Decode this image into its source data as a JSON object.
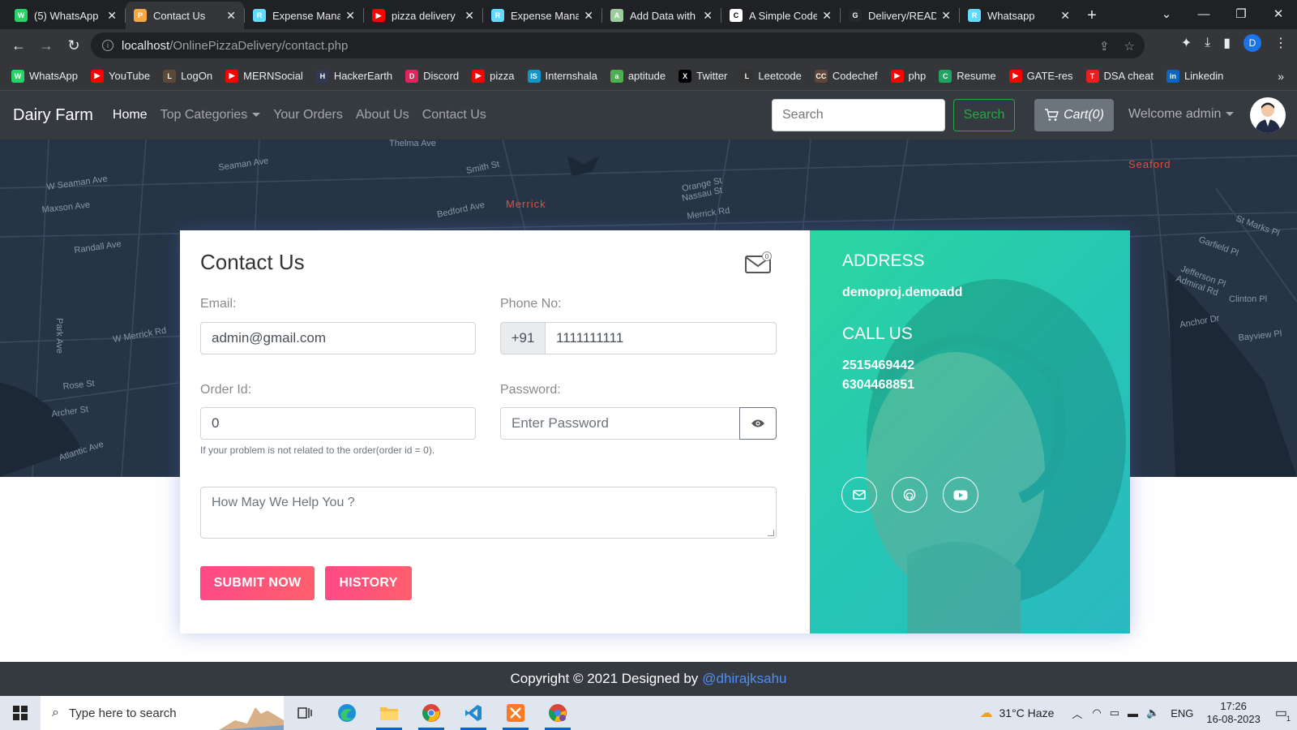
{
  "browser": {
    "tabs": [
      {
        "title": "(5) WhatsApp",
        "color": "#25d366",
        "glyph": "W",
        "active": false
      },
      {
        "title": "Contact Us",
        "color": "#f4a742",
        "glyph": "P",
        "active": true
      },
      {
        "title": "Expense Mana",
        "color": "#61dafb",
        "glyph": "R",
        "active": false
      },
      {
        "title": "pizza delivery",
        "color": "#ff0000",
        "glyph": "▶",
        "active": false
      },
      {
        "title": "Expense Mana",
        "color": "#61dafb",
        "glyph": "R",
        "active": false
      },
      {
        "title": "Add Data with",
        "color": "#9ccc9c",
        "glyph": "A",
        "active": false
      },
      {
        "title": "A Simple Code",
        "color": "#ffffff",
        "glyph": "C",
        "active": false
      },
      {
        "title": "Delivery/READ",
        "color": "#24292e",
        "glyph": "G",
        "active": false
      },
      {
        "title": "Whatsapp",
        "color": "#61dafb",
        "glyph": "R",
        "active": false
      }
    ],
    "url_host": "localhost",
    "url_path": "/OnlinePizzaDelivery/contact.php",
    "profile_initial": "D",
    "bookmarks": [
      {
        "label": "WhatsApp",
        "color": "#25d366",
        "glyph": "W"
      },
      {
        "label": "YouTube",
        "color": "#ff0000",
        "glyph": "▶"
      },
      {
        "label": "LogOn",
        "color": "#5a4a3a",
        "glyph": "L"
      },
      {
        "label": "MERNSocial",
        "color": "#ff0000",
        "glyph": "▶"
      },
      {
        "label": "HackerEarth",
        "color": "#323754",
        "glyph": "H"
      },
      {
        "label": "Discord",
        "color": "#e0245e",
        "glyph": "D"
      },
      {
        "label": "pizza",
        "color": "#ff0000",
        "glyph": "▶"
      },
      {
        "label": "Internshala",
        "color": "#1295c9",
        "glyph": "IS"
      },
      {
        "label": "aptitude",
        "color": "#4caf50",
        "glyph": "a"
      },
      {
        "label": "Twitter",
        "color": "#000000",
        "glyph": "X"
      },
      {
        "label": "Leetcode",
        "color": "#333333",
        "glyph": "L"
      },
      {
        "label": "Codechef",
        "color": "#5b4638",
        "glyph": "CC"
      },
      {
        "label": "php",
        "color": "#ff0000",
        "glyph": "▶"
      },
      {
        "label": "Resume",
        "color": "#1fa463",
        "glyph": "C"
      },
      {
        "label": "GATE-res",
        "color": "#ff0000",
        "glyph": "▶"
      },
      {
        "label": "DSA cheat",
        "color": "#e91e1e",
        "glyph": "T"
      },
      {
        "label": "Linkedin",
        "color": "#0a66c2",
        "glyph": "in"
      }
    ]
  },
  "nav": {
    "brand": "Dairy Farm",
    "links": [
      "Home",
      "Top Categories",
      "Your Orders",
      "About Us",
      "Contact Us"
    ],
    "search_placeholder": "Search",
    "search_button": "Search",
    "cart": "Cart(0)",
    "welcome": "Welcome admin"
  },
  "map_labels": [
    "W Seaman Ave",
    "Seaman Ave",
    "Maxson Ave",
    "Randall Ave",
    "W Merrick Rd",
    "Rose St",
    "Archer St",
    "Atlantic Ave",
    "Smith St",
    "Bedford Ave",
    "Merrick",
    "Orange St",
    "Nassau St",
    "Merrick Rd",
    "Seaford",
    "Garfield Pl",
    "Jefferson Pl",
    "Admiral Rd",
    "Anchor Dr",
    "Clinton Pl",
    "Bayview Pl",
    "St Marks Pl",
    "Thelma Ave",
    "Park Ave"
  ],
  "form": {
    "title": "Contact Us",
    "mail_badge": "0",
    "email_label": "Email:",
    "email_value": "admin@gmail.com",
    "phone_label": "Phone No:",
    "phone_prefix": "+91",
    "phone_value": "1111111111",
    "order_label": "Order Id:",
    "order_value": "0",
    "password_label": "Password:",
    "password_placeholder": "Enter Password",
    "helper": "If your problem is not related to the order(order id = 0).",
    "message_placeholder": "How May We Help You ?",
    "submit": "SUBMIT NOW",
    "history": "HISTORY"
  },
  "contact": {
    "address_heading": "ADDRESS",
    "address": "demoproj.demoadd",
    "call_heading": "CALL US",
    "phone1": "2515469442",
    "phone2": "6304468851"
  },
  "footer": {
    "text": "Copyright © 2021 Designed by",
    "credit": "@dhirajksahu"
  },
  "taskbar": {
    "search_placeholder": "Type here to search",
    "weather": "31°C  Haze",
    "lang": "ENG",
    "time": "17:26",
    "date": "16-08-2023",
    "notif_count": "1"
  }
}
